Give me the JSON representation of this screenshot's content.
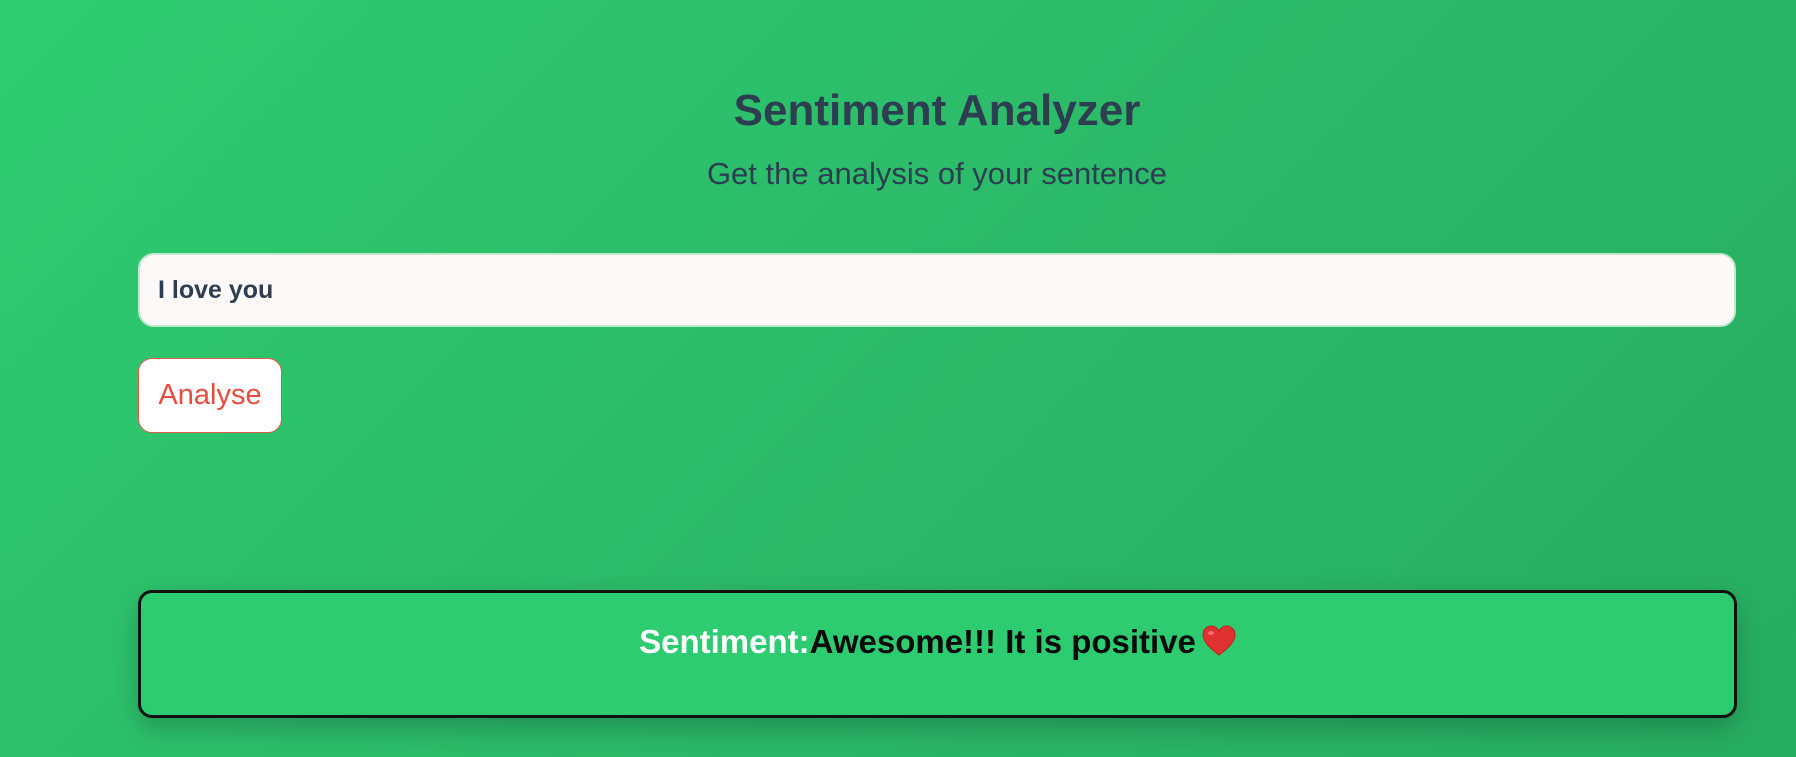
{
  "header": {
    "title": "Sentiment Analyzer",
    "subtitle": "Get the analysis of your sentence"
  },
  "form": {
    "input_value": "I love you",
    "analyse_label": "Analyse"
  },
  "result": {
    "label": "Sentiment:",
    "value": "Awesome!!! It is positive",
    "icon": "heart-icon"
  },
  "colors": {
    "background": "#2ecc71",
    "title_text": "#2c3e50",
    "button_text": "#e74c3c",
    "result_label": "#ffffff",
    "result_value": "#0a0a0a",
    "heart": "#e03131"
  }
}
